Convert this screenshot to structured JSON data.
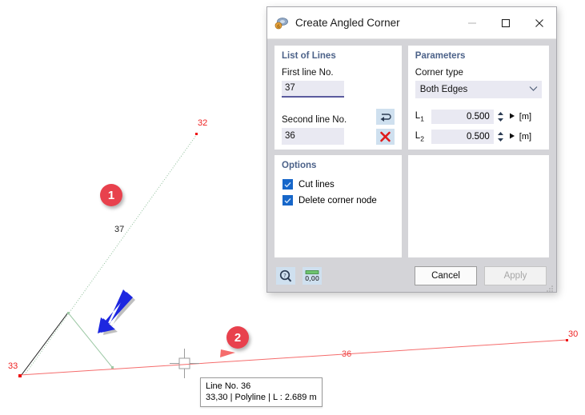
{
  "dialog": {
    "title": "Create Angled Corner",
    "icon": "angled-corner-icon",
    "window_controls": {
      "minimize": "minimize-icon",
      "maximize": "maximize-icon",
      "close": "close-icon"
    },
    "groups": {
      "list_of_lines": {
        "title": "List of Lines",
        "first_line_label": "First line No.",
        "first_line_value": "37",
        "second_line_label": "Second line No.",
        "second_line_value": "36",
        "swap_icon": "swap-arrow-icon",
        "delete_icon": "red-x-delete-icon"
      },
      "parameters": {
        "title": "Parameters",
        "corner_type_label": "Corner type",
        "corner_type_value": "Both Edges",
        "corner_type_options": [
          "Both Edges"
        ],
        "l1_label": "L",
        "l1_sub": "1",
        "l1_value": "0.500",
        "l1_unit": "[m]",
        "l2_label": "L",
        "l2_sub": "2",
        "l2_value": "0.500",
        "l2_unit": "[m]"
      },
      "options": {
        "title": "Options",
        "items": [
          {
            "label": "Cut lines",
            "checked": true
          },
          {
            "label": "Delete corner node",
            "checked": true
          }
        ]
      }
    },
    "footer": {
      "help_icon": "help-magnifier-icon",
      "units_icon": "number-format-icon",
      "cancel_label": "Cancel",
      "apply_label": "Apply",
      "apply_enabled": false,
      "resize_grip": "resize-grip-icon"
    }
  },
  "canvas": {
    "badges": [
      {
        "text": "1",
        "color": "#e8414d"
      },
      {
        "text": "2",
        "color": "#e8414d"
      }
    ],
    "node_labels": [
      {
        "text": "32",
        "color": "#ee2222"
      },
      {
        "text": "30",
        "color": "#ee2222"
      },
      {
        "text": "33",
        "color": "#ee2222"
      }
    ],
    "line_labels": [
      {
        "text": "37",
        "color": "#222222"
      },
      {
        "text": "36",
        "color": "#ee4444"
      }
    ],
    "tooltip": {
      "line1": "Line No. 36",
      "line2": "33,30 | Polyline  | L : 2.689 m"
    },
    "cursor": "crosshair-cursor",
    "annotation_arrow": "blue-pointer-arrow"
  }
}
